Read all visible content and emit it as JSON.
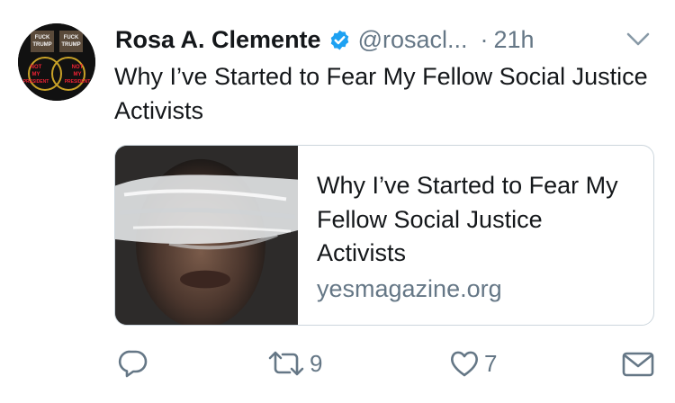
{
  "tweet": {
    "author_name": "Rosa A. Clemente",
    "handle": "@rosacl...",
    "time": "21h",
    "separator": "·",
    "text": "Why I’ve Started to Fear My Fellow Social Justice Activists",
    "avatar_text": [
      "FUCK",
      "TRUMP",
      "NOT",
      "MY",
      "PRESIDENT"
    ]
  },
  "card": {
    "title": "Why I’ve Started to Fear My Fellow Social Justice Activists",
    "domain": "yesmagazine.org"
  },
  "actions": {
    "reply_icon": "reply-icon",
    "retweet_icon": "retweet-icon",
    "retweet_count": "9",
    "like_icon": "heart-icon",
    "like_count": "7",
    "dm_icon": "envelope-icon"
  },
  "colors": {
    "text": "#14171a",
    "secondary": "#657786",
    "verified": "#1da1f2",
    "border": "#ccd6dd"
  }
}
